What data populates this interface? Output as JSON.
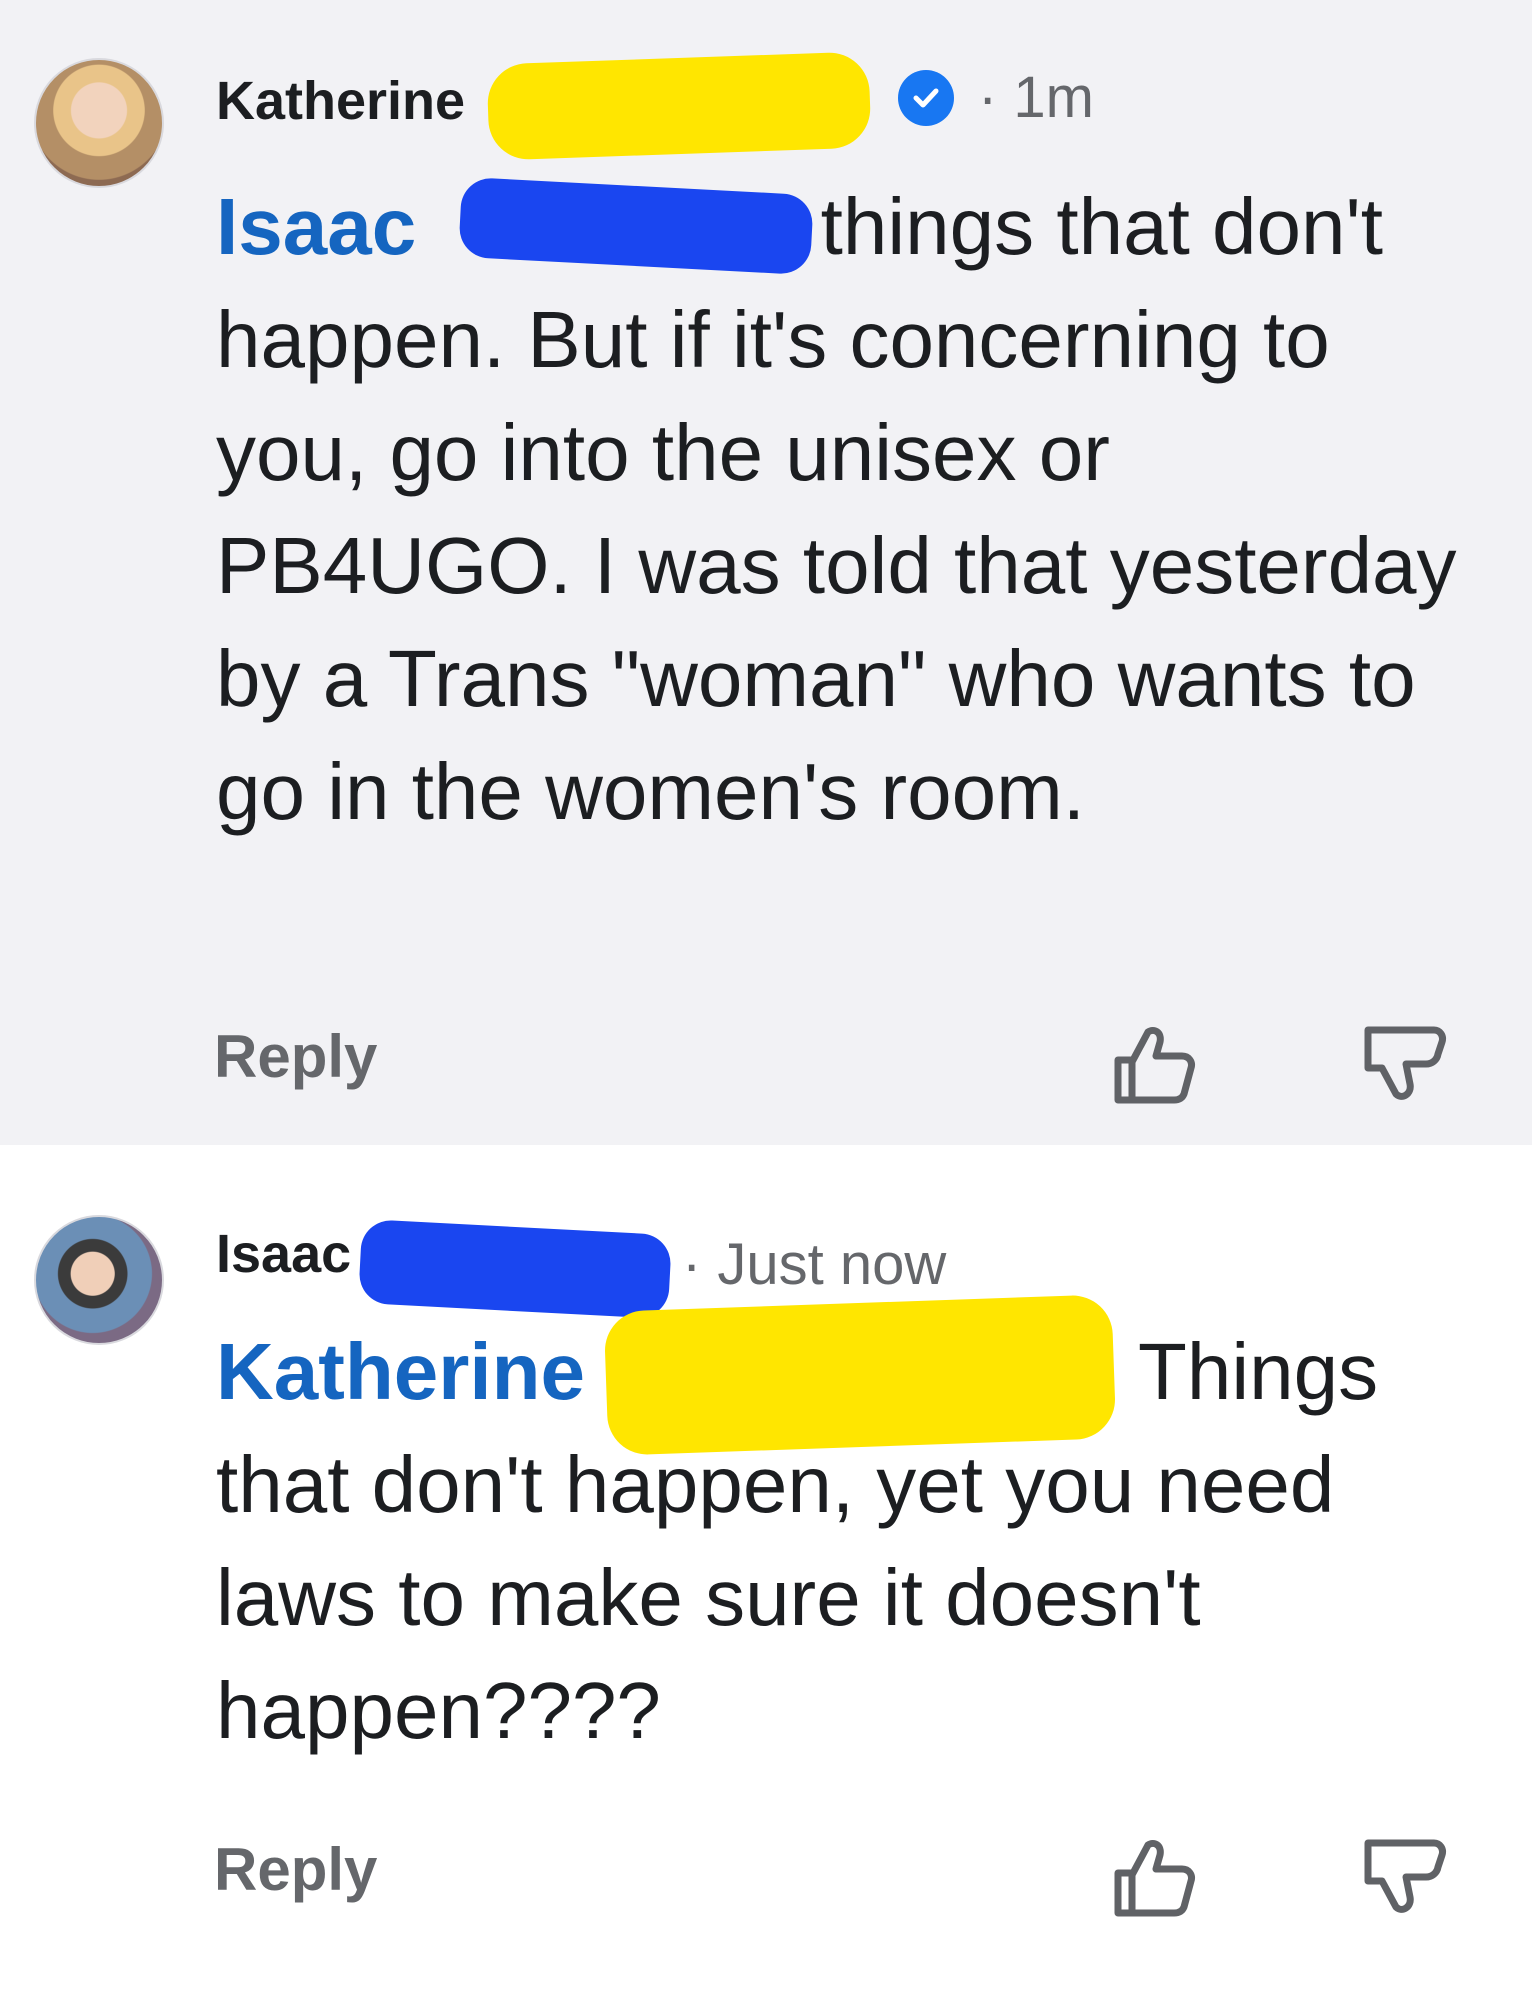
{
  "comments": [
    {
      "author": "Katherine",
      "verified": true,
      "time": "· 1m",
      "mention": "Isaac",
      "text_line1_tail": "things that don't",
      "text_rest": "happen.  But if it's concerning to you, go into the unisex or PB4UGO.  I was told that yesterday by a Trans \"woman\" who wants to go in the women's room.",
      "reply_label": "Reply",
      "like_icon": "thumbs-up-icon",
      "dislike_icon": "thumbs-down-icon"
    },
    {
      "author": "Isaac",
      "verified": false,
      "time": "· Just now",
      "mention": "Katherine",
      "text_line1_tail": "Things",
      "text_rest": "that don't happen, yet you need laws to make sure it doesn't happen????",
      "reply_label": "Reply",
      "like_icon": "thumbs-up-icon",
      "dislike_icon": "thumbs-down-icon"
    }
  ],
  "colors": {
    "mention": "#1565c0",
    "verified_badge": "#1877f2",
    "redaction_yellow": "#ffe600",
    "redaction_blue": "#1a46f0",
    "first_comment_bg": "#f2f2f5"
  }
}
